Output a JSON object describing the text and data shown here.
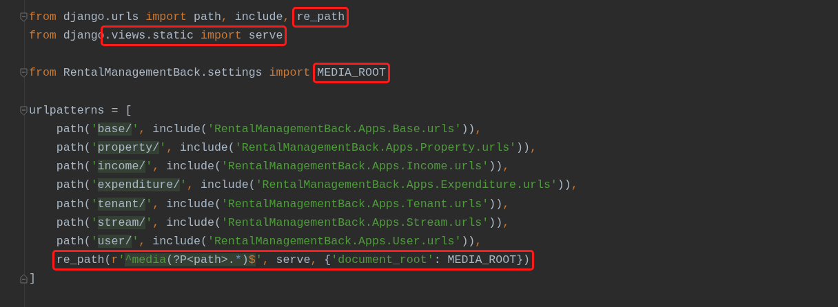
{
  "editor": {
    "lines": [
      {
        "fold_start": true,
        "fold_end": false,
        "parts": [
          {
            "kind": "kw",
            "text": "from"
          },
          {
            "kind": "id",
            "text": " django.urls "
          },
          {
            "kind": "kw",
            "text": "import"
          },
          {
            "kind": "id",
            "text": " path"
          },
          {
            "kind": "kw",
            "text": ","
          },
          {
            "kind": "id",
            "text": " include"
          },
          {
            "kind": "kw",
            "text": ", "
          },
          {
            "kind": "annotation",
            "parts": [
              {
                "kind": "id",
                "text": "re_path"
              }
            ]
          }
        ]
      },
      {
        "fold_start": false,
        "fold_end": false,
        "parts": [
          {
            "kind": "kw",
            "text": "from"
          },
          {
            "kind": "id",
            "text": " django"
          },
          {
            "kind": "annotation",
            "parts": [
              {
                "kind": "id",
                "text": ".views.static "
              },
              {
                "kind": "kw",
                "text": "import"
              },
              {
                "kind": "id",
                "text": " serve"
              }
            ]
          }
        ]
      },
      {
        "fold_start": false,
        "fold_end": false
      },
      {
        "fold_start": true,
        "fold_end": false,
        "parts": [
          {
            "kind": "kw",
            "text": "from"
          },
          {
            "kind": "id",
            "text": " RentalManagementBack.settings "
          },
          {
            "kind": "kw",
            "text": "import "
          },
          {
            "kind": "annotation",
            "parts": [
              {
                "kind": "id",
                "text": "MEDIA_ROOT"
              }
            ]
          }
        ]
      },
      {
        "fold_start": false,
        "fold_end": false
      },
      {
        "fold_start": true,
        "fold_end": false,
        "parts": [
          {
            "kind": "id",
            "text": "urlpatterns = ["
          }
        ]
      },
      {
        "fold_start": false,
        "fold_end": false,
        "parts": [
          {
            "kind": "id",
            "text": "    path("
          },
          {
            "kind": "str",
            "text": "'"
          },
          {
            "kind": "hl",
            "text": "base/"
          },
          {
            "kind": "str",
            "text": "'"
          },
          {
            "kind": "kw",
            "text": ","
          },
          {
            "kind": "id",
            "text": " include("
          },
          {
            "kind": "str",
            "text": "'RentalManagementBack.Apps.Base.urls'"
          },
          {
            "kind": "id",
            "text": "))"
          },
          {
            "kind": "kw",
            "text": ","
          }
        ]
      },
      {
        "fold_start": false,
        "fold_end": false,
        "parts": [
          {
            "kind": "id",
            "text": "    path("
          },
          {
            "kind": "str",
            "text": "'"
          },
          {
            "kind": "hl",
            "text": "property/"
          },
          {
            "kind": "str",
            "text": "'"
          },
          {
            "kind": "kw",
            "text": ","
          },
          {
            "kind": "id",
            "text": " include("
          },
          {
            "kind": "str",
            "text": "'RentalManagementBack.Apps.Property.urls'"
          },
          {
            "kind": "id",
            "text": "))"
          },
          {
            "kind": "kw",
            "text": ","
          }
        ]
      },
      {
        "fold_start": false,
        "fold_end": false,
        "parts": [
          {
            "kind": "id",
            "text": "    path("
          },
          {
            "kind": "str",
            "text": "'"
          },
          {
            "kind": "hl",
            "text": "income/"
          },
          {
            "kind": "str",
            "text": "'"
          },
          {
            "kind": "kw",
            "text": ","
          },
          {
            "kind": "id",
            "text": " include("
          },
          {
            "kind": "str",
            "text": "'RentalManagementBack.Apps.Income.urls'"
          },
          {
            "kind": "id",
            "text": "))"
          },
          {
            "kind": "kw",
            "text": ","
          }
        ]
      },
      {
        "fold_start": false,
        "fold_end": false,
        "parts": [
          {
            "kind": "id",
            "text": "    path("
          },
          {
            "kind": "str",
            "text": "'"
          },
          {
            "kind": "hl",
            "text": "expenditure/"
          },
          {
            "kind": "str",
            "text": "'"
          },
          {
            "kind": "kw",
            "text": ","
          },
          {
            "kind": "id",
            "text": " include("
          },
          {
            "kind": "str",
            "text": "'RentalManagementBack.Apps.Expenditure.urls'"
          },
          {
            "kind": "id",
            "text": "))"
          },
          {
            "kind": "kw",
            "text": ","
          }
        ]
      },
      {
        "fold_start": false,
        "fold_end": false,
        "parts": [
          {
            "kind": "id",
            "text": "    path("
          },
          {
            "kind": "str",
            "text": "'"
          },
          {
            "kind": "hl",
            "text": "tenant/"
          },
          {
            "kind": "str",
            "text": "'"
          },
          {
            "kind": "kw",
            "text": ","
          },
          {
            "kind": "id",
            "text": " include("
          },
          {
            "kind": "str",
            "text": "'RentalManagementBack.Apps.Tenant.urls'"
          },
          {
            "kind": "id",
            "text": "))"
          },
          {
            "kind": "kw",
            "text": ","
          }
        ]
      },
      {
        "fold_start": false,
        "fold_end": false,
        "parts": [
          {
            "kind": "id",
            "text": "    path("
          },
          {
            "kind": "str",
            "text": "'"
          },
          {
            "kind": "hl",
            "text": "stream/"
          },
          {
            "kind": "str",
            "text": "'"
          },
          {
            "kind": "kw",
            "text": ","
          },
          {
            "kind": "id",
            "text": " include("
          },
          {
            "kind": "str",
            "text": "'RentalManagementBack.Apps.Stream.urls'"
          },
          {
            "kind": "id",
            "text": "))"
          },
          {
            "kind": "kw",
            "text": ","
          }
        ]
      },
      {
        "fold_start": false,
        "fold_end": false,
        "parts": [
          {
            "kind": "id",
            "text": "    path("
          },
          {
            "kind": "str",
            "text": "'"
          },
          {
            "kind": "hl",
            "text": "user/"
          },
          {
            "kind": "str",
            "text": "'"
          },
          {
            "kind": "kw",
            "text": ","
          },
          {
            "kind": "id",
            "text": " include("
          },
          {
            "kind": "str",
            "text": "'RentalManagementBack.Apps.User.urls'"
          },
          {
            "kind": "id",
            "text": "))"
          },
          {
            "kind": "kw",
            "text": ","
          }
        ]
      },
      {
        "fold_start": false,
        "fold_end": false,
        "parts": [
          {
            "kind": "annotation",
            "parts": [
              {
                "kind": "id",
                "text": "    re_path("
              },
              {
                "kind": "kw",
                "text": "r"
              },
              {
                "kind": "str",
                "text": "'"
              },
              {
                "kind": "hlstr",
                "text": "^media"
              },
              {
                "kind": "hl",
                "text": "(?P<path>."
              },
              {
                "kind": "hlop",
                "text": "*"
              },
              {
                "kind": "hl",
                "text": ")"
              },
              {
                "kind": "hlkw",
                "text": "$"
              },
              {
                "kind": "str",
                "text": "'"
              },
              {
                "kind": "kw",
                "text": ","
              },
              {
                "kind": "id",
                "text": " serve"
              },
              {
                "kind": "kw",
                "text": ","
              },
              {
                "kind": "id",
                "text": " {"
              },
              {
                "kind": "str",
                "text": "'document_root'"
              },
              {
                "kind": "id",
                "text": ": MEDIA_ROOT})"
              }
            ]
          }
        ]
      },
      {
        "fold_start": false,
        "fold_end": true,
        "parts": [
          {
            "kind": "id",
            "text": "]"
          }
        ]
      }
    ]
  }
}
